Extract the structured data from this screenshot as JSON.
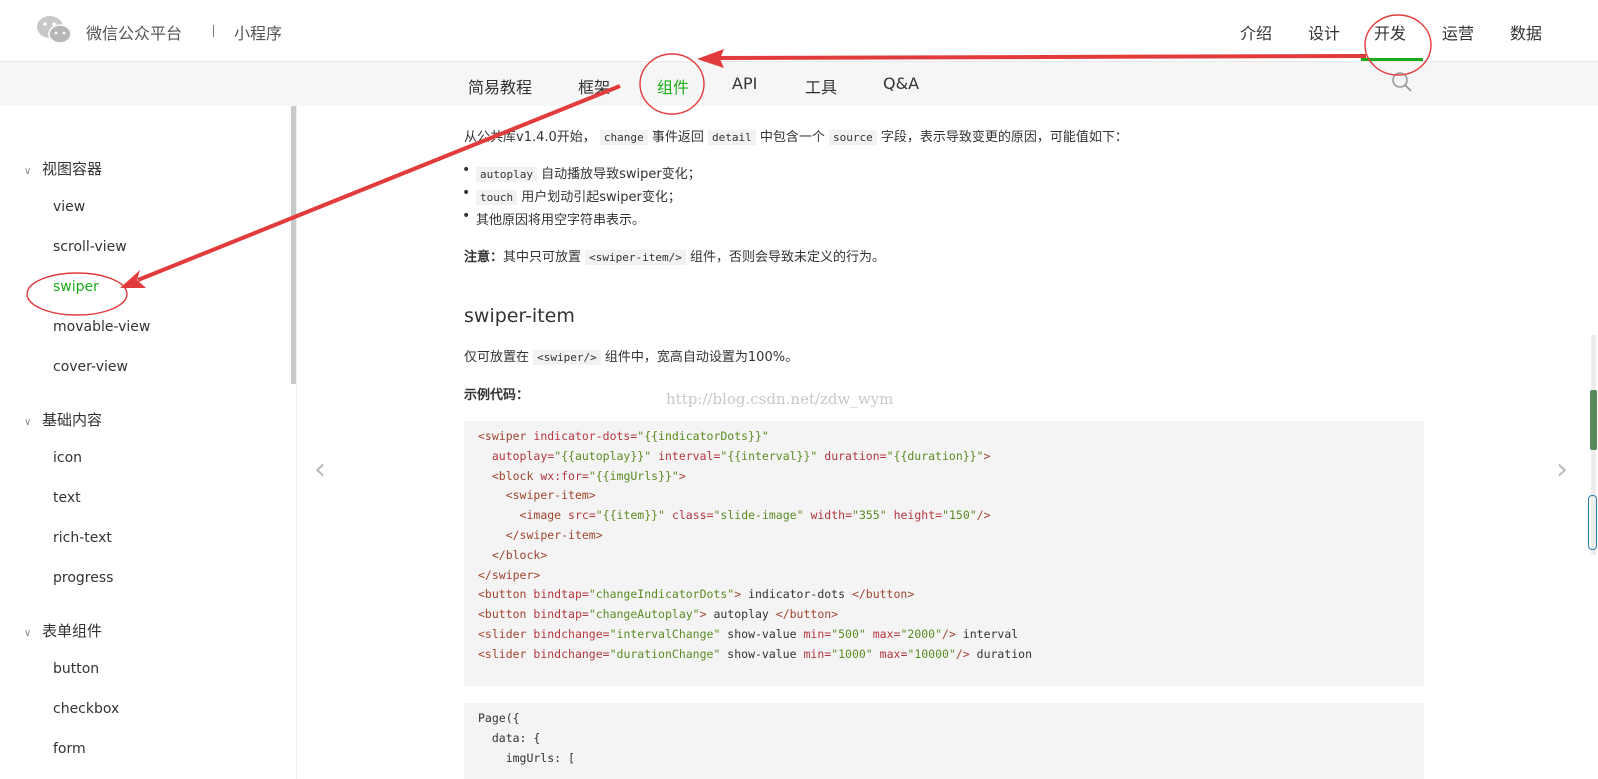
{
  "header": {
    "brand": "微信公众平台",
    "brand_sub": "小程序",
    "nav": [
      "介绍",
      "设计",
      "开发",
      "运营",
      "数据"
    ]
  },
  "subnav": [
    "简易教程",
    "框架",
    "组件",
    "API",
    "工具",
    "Q&A"
  ],
  "sidebar": {
    "groups": [
      {
        "label": "视图容器",
        "items": [
          "view",
          "scroll-view",
          "swiper",
          "movable-view",
          "cover-view"
        ]
      },
      {
        "label": "基础内容",
        "items": [
          "icon",
          "text",
          "rich-text",
          "progress"
        ]
      },
      {
        "label": "表单组件",
        "items": [
          "button",
          "checkbox",
          "form"
        ]
      }
    ]
  },
  "content": {
    "intro_pre": "从公共库v1.4.0开始，",
    "intro_code1": "change",
    "intro_mid1": "事件返回",
    "intro_code2": "detail",
    "intro_mid2": "中包含一个",
    "intro_code3": "source",
    "intro_post": "字段，表示导致变更的原因，可能值如下：",
    "bullets": [
      {
        "code": "autoplay",
        "text": "自动播放导致swiper变化；"
      },
      {
        "code": "touch",
        "text": "用户划动引起swiper变化；"
      },
      {
        "code": "",
        "text": "其他原因将用空字符串表示。"
      }
    ],
    "note_label": "注意：",
    "note_pre": "其中只可放置",
    "note_code": "<swiper-item/>",
    "note_post": "组件，否则会导致未定义的行为。",
    "h2": "swiper-item",
    "p2_pre": "仅可放置在",
    "p2_code": "<swiper/>",
    "p2_post": "组件中，宽高自动设置为100%。",
    "example_label": "示例代码：",
    "watermark": "http://blog.csdn.net/zdw_wym",
    "code1": [
      "<swiper indicator-dots=\"{{indicatorDots}}\"",
      "  autoplay=\"{{autoplay}}\" interval=\"{{interval}}\" duration=\"{{duration}}\">",
      "  <block wx:for=\"{{imgUrls}}\">",
      "    <swiper-item>",
      "      <image src=\"{{item}}\" class=\"slide-image\" width=\"355\" height=\"150\"/>",
      "    </swiper-item>",
      "  </block>",
      "</swiper>",
      "<button bindtap=\"changeIndicatorDots\"> indicator-dots </button>",
      "<button bindtap=\"changeAutoplay\"> autoplay </button>",
      "<slider bindchange=\"intervalChange\" show-value min=\"500\" max=\"2000\"/> interval",
      "<slider bindchange=\"durationChange\" show-value min=\"1000\" max=\"10000\"/> duration"
    ],
    "code2": [
      "Page({",
      "  data: {",
      "    imgUrls: ["
    ]
  },
  "colors": {
    "accent": "#1aad19",
    "annotation": "#e23b3b"
  },
  "icons": {
    "logo": "wechat-logo-icon",
    "search": "search-icon",
    "prev": "chevron-left-icon",
    "next": "chevron-right-icon"
  }
}
